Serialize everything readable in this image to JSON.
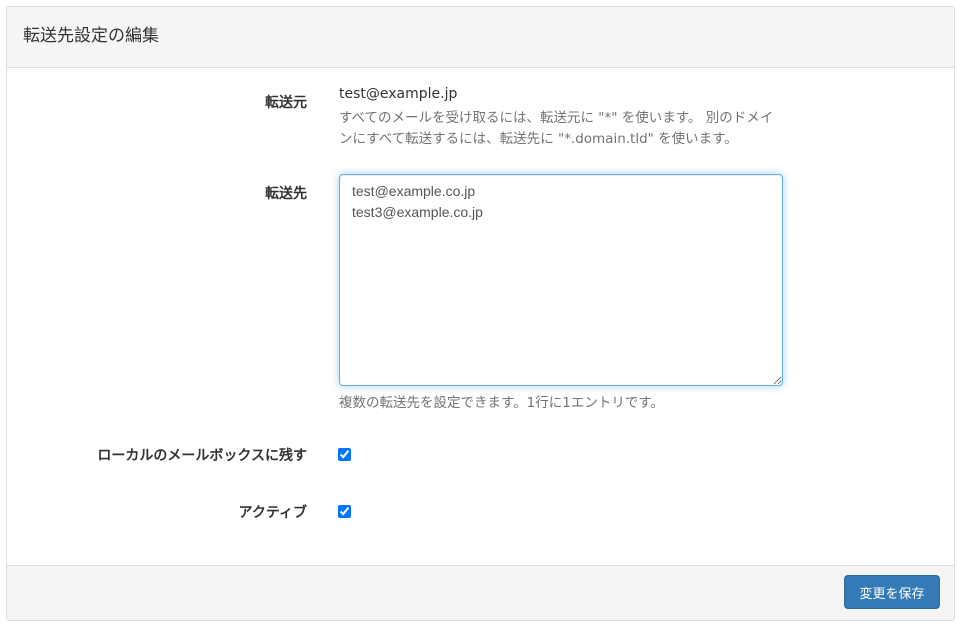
{
  "panel": {
    "title": "転送先設定の編集"
  },
  "form": {
    "source": {
      "label": "転送元",
      "value": "test@example.jp",
      "help": "すべてのメールを受け取るには、転送元に \"*\" を使います。 別のドメインにすべて転送するには、転送先に \"*.domain.tld\" を使います。"
    },
    "destination": {
      "label": "転送先",
      "value": "test@example.co.jp\ntest3@example.co.jp",
      "help": "複数の転送先を設定できます。1行に1エントリです。"
    },
    "keep_local": {
      "label": "ローカルのメールボックスに残す",
      "checked": true
    },
    "active": {
      "label": "アクティブ",
      "checked": true
    }
  },
  "footer": {
    "save_label": "変更を保存"
  },
  "colors": {
    "primary": "#337ab7",
    "focus_border": "#66afe9",
    "heading_bg": "#f5f5f5"
  }
}
